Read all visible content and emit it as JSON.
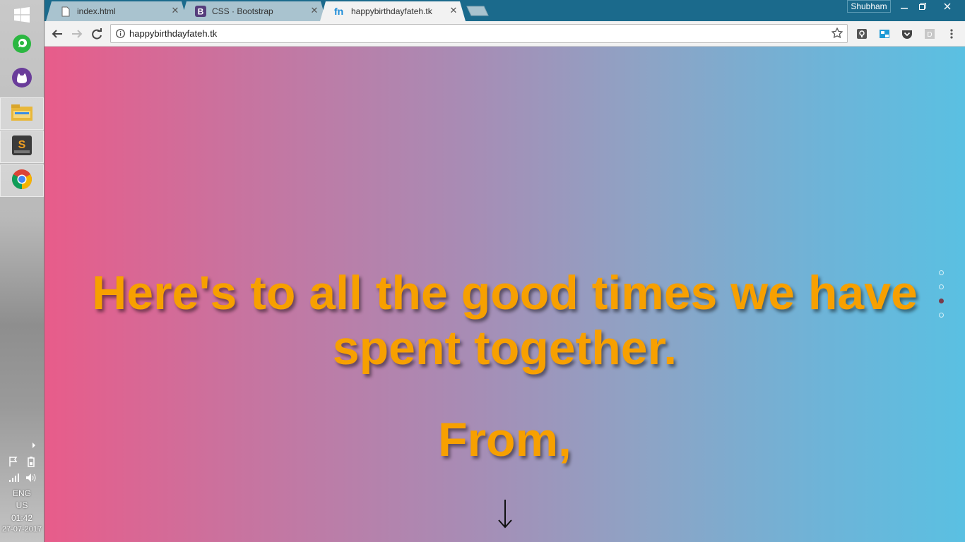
{
  "taskbar": {
    "apps": [
      {
        "name": "windows-start",
        "icon": "windows-logo-icon"
      },
      {
        "name": "whatsapp",
        "icon": "whatsapp-icon"
      },
      {
        "name": "cat-app",
        "icon": "cat-icon"
      },
      {
        "name": "file-explorer",
        "icon": "folder-icon"
      },
      {
        "name": "sublime-text",
        "icon": "sublime-icon"
      },
      {
        "name": "chrome",
        "icon": "chrome-icon"
      }
    ],
    "tray": {
      "language": "ENG",
      "region": "US",
      "time": "01:42",
      "date": "27-07-2017"
    }
  },
  "browser": {
    "profile_name": "Shubham",
    "tabs": [
      {
        "title": "index.html",
        "icon": "file-icon",
        "active": false
      },
      {
        "title": "CSS · Bootstrap",
        "icon": "bootstrap-icon",
        "active": false
      },
      {
        "title": "happybirthdayfateh.tk",
        "icon": "fn-icon",
        "active": true
      }
    ],
    "url": "happybirthdayfateh.tk",
    "extensions": [
      "keep-icon",
      "cast-icon",
      "pocket-icon",
      "d-extension-icon"
    ],
    "colors": {
      "tabstrip": "#1b6a8c",
      "accent": "#f7a000"
    }
  },
  "page": {
    "headline": "Here's to all the good times we have spent together.",
    "from_text": "From,",
    "scroll_arrow": "↓",
    "slide_dots": {
      "count": 4,
      "active_index": 2
    }
  }
}
